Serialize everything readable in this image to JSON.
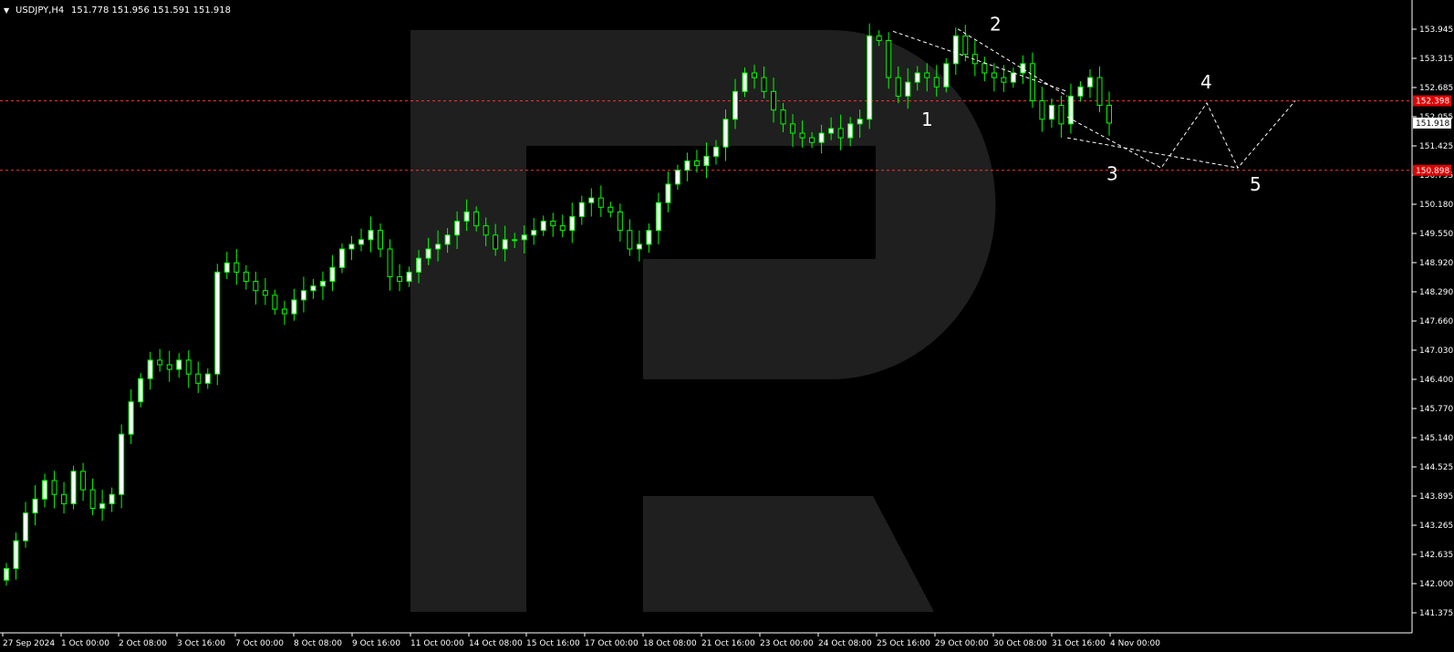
{
  "header": {
    "symbol_timeframe": "USDJPY,H4",
    "ohlc": "151.778 151.956 151.591 151.918"
  },
  "colors": {
    "background": "#000000",
    "candle": "#00ff00",
    "bull_body": "#ffffff",
    "bear_body": "#000000",
    "level_line": "#ff3333",
    "level_badge": "#e00000",
    "price_badge": "#ffffff",
    "forecast": "#ffffff",
    "watermark": "#1f1f1f"
  },
  "chart_data": {
    "type": "candlestick",
    "symbol": "USDJPY",
    "timeframe": "H4",
    "ylim": [
      141.375,
      154.2
    ],
    "y_ticks": [
      "153.945",
      "153.315",
      "152.685",
      "152.055",
      "151.425",
      "150.795",
      "150.180",
      "149.550",
      "148.920",
      "148.290",
      "147.660",
      "147.030",
      "146.400",
      "145.770",
      "145.140",
      "144.525",
      "143.895",
      "143.265",
      "142.635",
      "142.000",
      "141.375"
    ],
    "x_ticks": [
      "27 Sep 2024",
      "1 Oct 00:00",
      "2 Oct 08:00",
      "3 Oct 16:00",
      "7 Oct 00:00",
      "8 Oct 08:00",
      "9 Oct 16:00",
      "11 Oct 00:00",
      "14 Oct 08:00",
      "15 Oct 16:00",
      "17 Oct 00:00",
      "18 Oct 08:00",
      "21 Oct 16:00",
      "23 Oct 00:00",
      "24 Oct 08:00",
      "25 Oct 16:00",
      "29 Oct 00:00",
      "30 Oct 08:00",
      "31 Oct 16:00",
      "4 Nov 00:00"
    ],
    "levels": [
      {
        "value": 152.398,
        "label": "152.398"
      },
      {
        "value": 150.898,
        "label": "150.898"
      }
    ],
    "current_price": {
      "value": 151.918,
      "label": "151.918"
    },
    "close_path": [
      142.3,
      142.9,
      143.5,
      143.8,
      144.2,
      143.9,
      143.7,
      144.4,
      144.0,
      143.6,
      143.7,
      143.9,
      145.2,
      145.9,
      146.4,
      146.8,
      146.7,
      146.6,
      146.8,
      146.5,
      146.3,
      146.5,
      148.7,
      148.9,
      148.7,
      148.5,
      148.3,
      148.2,
      147.9,
      147.8,
      148.1,
      148.3,
      148.4,
      148.5,
      148.8,
      149.2,
      149.3,
      149.4,
      149.6,
      149.2,
      148.6,
      148.5,
      148.7,
      149.0,
      149.2,
      149.3,
      149.5,
      149.8,
      150.0,
      149.7,
      149.5,
      149.2,
      149.4,
      149.4,
      149.5,
      149.6,
      149.8,
      149.7,
      149.6,
      149.9,
      150.2,
      150.3,
      150.1,
      150.0,
      149.6,
      149.2,
      149.3,
      149.6,
      150.2,
      150.6,
      150.9,
      151.1,
      151.0,
      151.2,
      151.4,
      152.0,
      152.6,
      153.0,
      152.9,
      152.6,
      152.2,
      151.9,
      151.7,
      151.6,
      151.5,
      151.7,
      151.8,
      151.6,
      151.9,
      152.0,
      153.8,
      153.7,
      152.9,
      152.5,
      152.8,
      153.0,
      152.9,
      152.7,
      153.2,
      153.8,
      153.4,
      153.2,
      153.0,
      152.9,
      152.8,
      153.0,
      153.2,
      152.4,
      152.0,
      152.3,
      151.9,
      152.5,
      152.7,
      152.9,
      152.3,
      151.918
    ],
    "wave_labels": [
      "1",
      "2",
      "3",
      "4",
      "5"
    ],
    "forecast_path": [
      151.8,
      150.95,
      152.35,
      150.95,
      152.4
    ]
  }
}
